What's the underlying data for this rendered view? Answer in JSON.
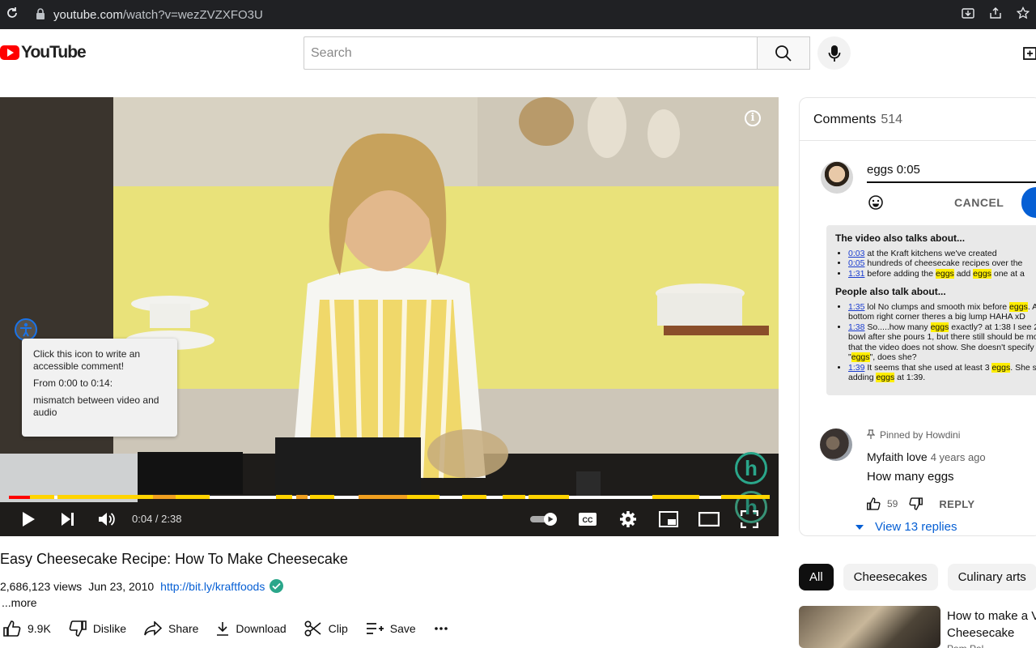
{
  "browser": {
    "url_host": "youtube.com",
    "url_path": "/watch?v=wezZVZXFO3U"
  },
  "masthead": {
    "logo_text": "YouTube",
    "search_placeholder": "Search"
  },
  "player": {
    "tooltip": {
      "line1": "Click this icon to write an accessible comment!",
      "line2": "From 0:00 to 0:14:",
      "line3": "mismatch between video and audio"
    },
    "time": "0:04 / 2:38",
    "progress_played_fraction": 0.027,
    "colors": {
      "played": "#ff0000",
      "highlight_yellow": "#ffd400",
      "highlight_orange": "#f0a020"
    }
  },
  "video": {
    "title": "Easy Cheesecake Recipe: How To Make Cheesecake",
    "views": "2,686,123 views",
    "date": "Jun 23, 2010",
    "link": "http://bit.ly/kraftfoods",
    "more": "...more",
    "actions": {
      "like_count": "9.9K",
      "dislike": "Dislike",
      "share": "Share",
      "download": "Download",
      "clip": "Clip",
      "save": "Save"
    }
  },
  "comments": {
    "header": "Comments",
    "count": "514",
    "input_value": "eggs 0:05",
    "cancel_label": "CANCEL",
    "also_talks": {
      "heading": "The video also talks about...",
      "items": [
        {
          "ts": "0:03",
          "pre": "at the Kraft kitchens we've created",
          "hl": "",
          "post": ""
        },
        {
          "ts": "0:05",
          "pre": "hundreds of cheesecake recipes over the",
          "hl": "",
          "post": ""
        },
        {
          "ts": "1:31",
          "pre": "before adding the ",
          "hl": "eggs",
          "post": " add ",
          "hl2": "eggs",
          "post2": " one at a"
        }
      ]
    },
    "people_talk": {
      "heading": "People also talk about...",
      "items": [
        {
          "ts": "1:35",
          "text1": "lol No clumps and smooth mix before ",
          "hl1": "eggs",
          "text2": ". A",
          "line2": "bottom right corner theres a big lump HAHA xD"
        },
        {
          "ts": "1:38",
          "text1": "So.....how many ",
          "hl1": "eggs",
          "text2": " exactly? at 1:38 I see 2",
          "line2": "bowl after she pours 1, but there still should be mo",
          "line3": "that the video does not show. She doesn't specify b",
          "hl_line4": "eggs",
          "line4_post": "\", does she?"
        },
        {
          "ts": "1:39",
          "text1": "It seems that she used at least 3 ",
          "hl1": "eggs",
          "text2": ". She st",
          "line2_pre": "adding ",
          "hl2": "eggs",
          "line2_post": " at 1:39."
        }
      ]
    },
    "pinned": {
      "label": "Pinned by Howdini",
      "author": "Myfaith love",
      "age": "4 years ago",
      "text": "How many eggs",
      "likes": "59",
      "reply": "REPLY",
      "view_replies": "View 13 replies"
    }
  },
  "chips": [
    "All",
    "Cheesecakes",
    "Culinary arts"
  ],
  "recommendation": {
    "title_line1": "How to make a V",
    "title_line2": "Cheesecake",
    "channel": "Pam Pal..."
  }
}
